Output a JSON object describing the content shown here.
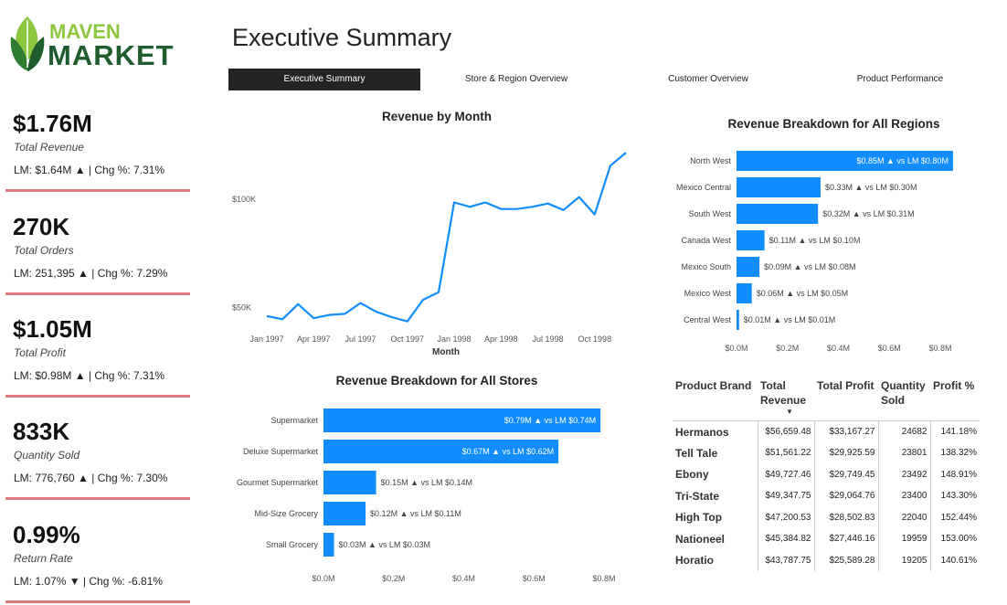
{
  "logo": {
    "line1": "MAVEN",
    "line2": "MARKET"
  },
  "page": {
    "title": "Executive Summary"
  },
  "tabs": [
    {
      "label": "Executive Summary",
      "active": true
    },
    {
      "label": "Store & Region Overview",
      "active": false
    },
    {
      "label": "Customer Overview",
      "active": false
    },
    {
      "label": "Product Performance",
      "active": false
    }
  ],
  "kpis": [
    {
      "value": "$1.76M",
      "label": "Total Revenue",
      "sub": "LM: $1.64M ▲ | Chg %: 7.31%"
    },
    {
      "value": "270K",
      "label": "Total Orders",
      "sub": "LM: 251,395 ▲ | Chg %: 7.29%"
    },
    {
      "value": "$1.05M",
      "label": "Total Profit",
      "sub": "LM: $0.98M ▲ | Chg %: 7.31%"
    },
    {
      "value": "833K",
      "label": "Quantity Sold",
      "sub": "LM: 776,760 ▲ | Chg %: 7.30%"
    },
    {
      "value": "0.99%",
      "label": "Return Rate",
      "sub": "LM: 1.07% ▼ | Chg %: -6.81%"
    }
  ],
  "colors": {
    "accent": "#118dff",
    "kpi_line": "#e07a7f",
    "active_tab": "#252423",
    "logo_green": "#8dc63f",
    "logo_dark": "#1f5c2e"
  },
  "chart_data": [
    {
      "type": "line",
      "title": "Revenue by Month",
      "xlabel": "Month",
      "ylabel": "",
      "x_ticks": [
        "Jan 1997",
        "Apr 1997",
        "Jul 1997",
        "Oct 1997",
        "Jan 1998",
        "Apr 1998",
        "Jul 1998",
        "Oct 1998"
      ],
      "y_ticks": [
        "$50K",
        "$100K"
      ],
      "ylim": [
        40000,
        130000
      ],
      "x": [
        "Jan 1997",
        "Feb 1997",
        "Mar 1997",
        "Apr 1997",
        "May 1997",
        "Jun 1997",
        "Jul 1997",
        "Aug 1997",
        "Sep 1997",
        "Oct 1997",
        "Nov 1997",
        "Dec 1997",
        "Jan 1998",
        "Feb 1998",
        "Mar 1998",
        "Apr 1998",
        "May 1998",
        "Jun 1998",
        "Jul 1998",
        "Aug 1998",
        "Sep 1998",
        "Oct 1998",
        "Nov 1998",
        "Dec 1998"
      ],
      "values": [
        46000,
        44500,
        51500,
        45000,
        46500,
        47000,
        52000,
        48000,
        45500,
        43500,
        53500,
        57000,
        98500,
        96500,
        98500,
        95500,
        95500,
        96500,
        98000,
        95000,
        101000,
        93000,
        115500,
        121500
      ]
    },
    {
      "type": "bar",
      "orientation": "horizontal",
      "title": "Revenue Breakdown for All Regions",
      "categories": [
        "North West",
        "Mexico Central",
        "South West",
        "Canada West",
        "Mexico South",
        "Mexico West",
        "Central West"
      ],
      "values": [
        0.85,
        0.33,
        0.32,
        0.11,
        0.09,
        0.06,
        0.01
      ],
      "data_labels": [
        "$0.85M ▲ vs LM $0.80M",
        "$0.33M ▲ vs LM $0.30M",
        "$0.32M ▲ vs LM $0.31M",
        "$0.11M ▲ vs LM $0.10M",
        "$0.09M ▲ vs LM $0.08M",
        "$0.06M ▲ vs LM $0.05M",
        "$0.01M ▲ vs LM $0.01M"
      ],
      "x_ticks": [
        "$0.0M",
        "$0.2M",
        "$0.4M",
        "$0.6M",
        "$0.8M"
      ],
      "xlim": [
        0,
        0.8
      ]
    },
    {
      "type": "bar",
      "orientation": "horizontal",
      "title": "Revenue Breakdown for All Stores",
      "categories": [
        "Supermarket",
        "Deluxe Supermarket",
        "Gourmet Supermarket",
        "Mid-Size Grocery",
        "Small Grocery"
      ],
      "values": [
        0.79,
        0.67,
        0.15,
        0.12,
        0.03
      ],
      "data_labels": [
        "$0.79M ▲ vs LM $0.74M",
        "$0.67M ▲ vs LM $0.62M",
        "$0.15M ▲ vs LM $0.14M",
        "$0.12M ▲ vs LM $0.11M",
        "$0.03M ▲ vs LM $0.03M"
      ],
      "x_ticks": [
        "$0.0M",
        "$0.2M",
        "$0.4M",
        "$0.6M",
        "$0.8M"
      ],
      "xlim": [
        0,
        0.8
      ]
    },
    {
      "type": "table",
      "headers": [
        "Product Brand",
        "Total Revenue",
        "Total Profit",
        "Quantity Sold",
        "Profit %"
      ],
      "sort_indicator": "▼",
      "rows": [
        [
          "Hermanos",
          "$56,659.48",
          "$33,167.27",
          "24682",
          "141.18%"
        ],
        [
          "Tell Tale",
          "$51,561.22",
          "$29,925.59",
          "23801",
          "138.32%"
        ],
        [
          "Ebony",
          "$49,727.46",
          "$29,749.45",
          "23492",
          "148.91%"
        ],
        [
          "Tri-State",
          "$49,347.75",
          "$29,064.76",
          "23400",
          "143.30%"
        ],
        [
          "High Top",
          "$47,200.53",
          "$28,502.83",
          "22040",
          "152.44%"
        ],
        [
          "Nationeel",
          "$45,384.82",
          "$27,446.16",
          "19959",
          "153.00%"
        ],
        [
          "Horatio",
          "$43,787.75",
          "$25,589.28",
          "19205",
          "140.61%"
        ]
      ]
    }
  ]
}
